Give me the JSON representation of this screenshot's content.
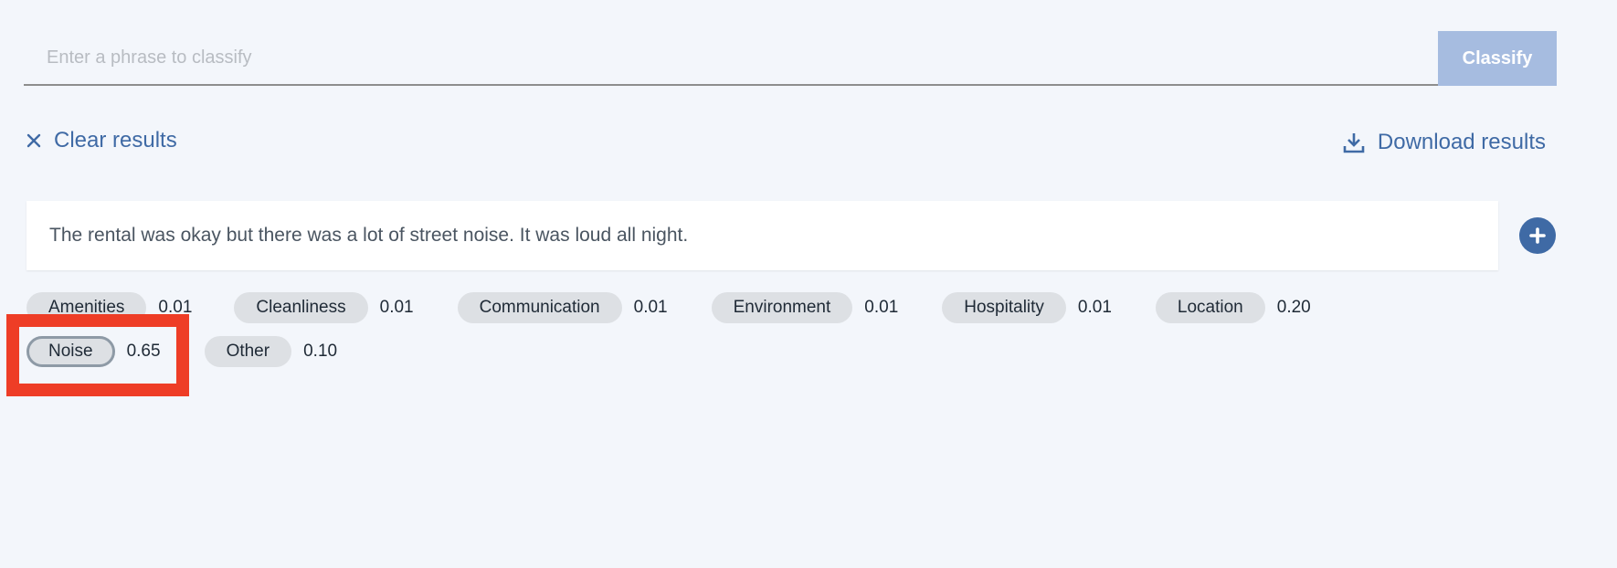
{
  "search": {
    "placeholder": "Enter a phrase to classify",
    "value": "",
    "button_label": "Classify"
  },
  "actions": {
    "clear_label": "Clear results",
    "download_label": "Download results"
  },
  "result": {
    "phrase": "The rental was okay but there was a lot of street noise. It was loud all night."
  },
  "labels": [
    {
      "name": "Amenities",
      "score": "0.01"
    },
    {
      "name": "Cleanliness",
      "score": "0.01"
    },
    {
      "name": "Communication",
      "score": "0.01"
    },
    {
      "name": "Environment",
      "score": "0.01"
    },
    {
      "name": "Hospitality",
      "score": "0.01"
    },
    {
      "name": "Location",
      "score": "0.20"
    },
    {
      "name": "Noise",
      "score": "0.65",
      "selected": true
    },
    {
      "name": "Other",
      "score": "0.10"
    }
  ],
  "colors": {
    "accent": "#3f6aa5",
    "button_disabled": "#a6bce0",
    "highlight": "#ee3d26",
    "pill_bg": "#dde0e4"
  },
  "icons": {
    "clear": "close-icon",
    "download": "download-icon",
    "add": "plus-icon"
  }
}
